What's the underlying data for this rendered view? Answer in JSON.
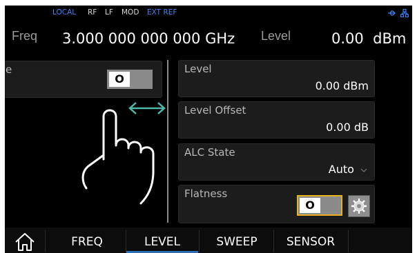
{
  "status_bar": {
    "local": "LOCAL",
    "rf": "RF",
    "lf": "LF",
    "mod": "MOD",
    "ext_ref": "EXT REF",
    "usb_icon": "usb-icon",
    "network_icon": "network-icon"
  },
  "header": {
    "freq_label": "Freq",
    "freq_value": "3.000 000 000 000",
    "freq_unit": "GHz",
    "level_label": "Level",
    "level_value": "0.00",
    "level_unit": "dBm"
  },
  "left_panel": {
    "title_partial": "e",
    "toggle_value": "O"
  },
  "right_panel": [
    {
      "title": "Level",
      "value": "0.00 dBm"
    },
    {
      "title": "Level Offset",
      "value": "0.00 dB"
    },
    {
      "title": "ALC State",
      "value": "Auto"
    },
    {
      "title": "Flatness",
      "toggle_value": "O"
    }
  ],
  "overlay": {
    "gesture_icon": "swipe-hand-icon",
    "arrow_icon": "double-arrow-icon"
  },
  "tabs": [
    {
      "label": "FREQ"
    },
    {
      "label": "LEVEL",
      "active": true
    },
    {
      "label": "SWEEP"
    },
    {
      "label": "SENSOR"
    }
  ],
  "colors": {
    "status_blue": "#3b82f6",
    "accent_teal": "#4fb8a8",
    "highlight_yellow": "#e8b21e",
    "tab_active_underline": "#2d6fb0"
  }
}
